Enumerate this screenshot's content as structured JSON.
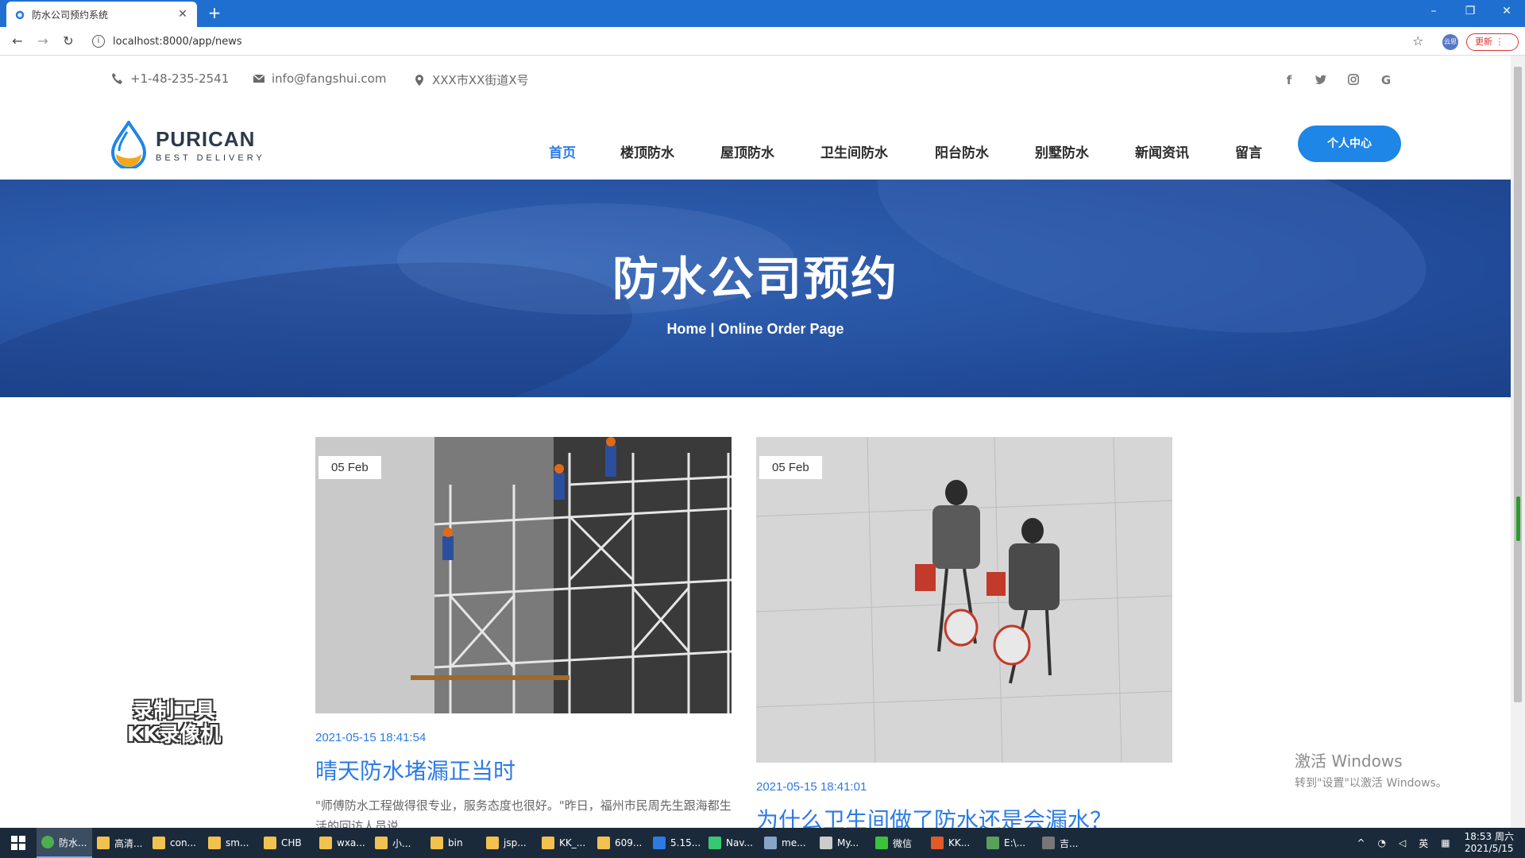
{
  "browser": {
    "tab_title": "防水公司预约系统",
    "url": "localhost:8000/app/news",
    "update_label": "更新",
    "profile_label": "云思"
  },
  "topbar": {
    "phone": "+1-48-235-2541",
    "email": "info@fangshui.com",
    "address": "XXX市XX街道X号",
    "social": [
      "facebook-icon",
      "twitter-icon",
      "instagram-icon",
      "google-icon"
    ]
  },
  "brand": {
    "name": "PURICAN",
    "tagline": "BEST DELIVERY"
  },
  "nav": {
    "items": [
      "首页",
      "楼顶防水",
      "屋顶防水",
      "卫生间防水",
      "阳台防水",
      "别墅防水",
      "新闻资讯",
      "留言"
    ],
    "active_index": 0,
    "cta": "个人中心"
  },
  "hero": {
    "title": "防水公司预约",
    "breadcrumb_home": "Home",
    "breadcrumb_sep": " | ",
    "breadcrumb_page": "Online Order Page"
  },
  "articles": [
    {
      "date_badge": "05 Feb",
      "timestamp": "2021-05-15 18:41:54",
      "title": "晴天防水堵漏正当时",
      "excerpt": "\"师傅防水工程做得很专业，服务态度也很好。\"昨日，福州市民周先生跟海都生活的回访人员说"
    },
    {
      "date_badge": "05 Feb",
      "timestamp": "2021-05-15 18:41:01",
      "title": "为什么卫生间做了防水还是会漏水？",
      "excerpt": ""
    }
  ],
  "overlay": {
    "recorder_line1": "录制工具",
    "recorder_line2": "KK录像机",
    "activate_title": "激活 Windows",
    "activate_sub": "转到\"设置\"以激活 Windows。"
  },
  "taskbar": {
    "items": [
      "防水...",
      "高清...",
      "con...",
      "sm...",
      "CHB",
      "wxa...",
      "小...",
      "bin",
      "jsp...",
      "KK_...",
      "609...",
      "5.15...",
      "Nav...",
      "me...",
      "My...",
      "微信",
      "KK...",
      "E:\\...",
      "吉..."
    ],
    "ime": "英",
    "time": "18:53 周六",
    "date": "2021/5/15"
  },
  "colors": {
    "accent": "#2c7be5",
    "hero_blue": "#2a58a8",
    "cta_blue": "#1e86e6",
    "chrome_blue": "#1f6fd1"
  }
}
